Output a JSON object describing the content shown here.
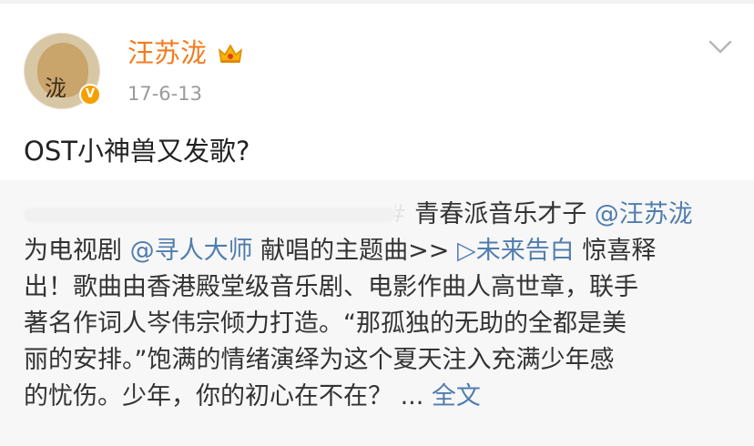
{
  "post": {
    "user": {
      "name": "汪苏泷",
      "avatar_text": "泷",
      "verified_badge": "v-badge-icon",
      "crown": "crown-icon"
    },
    "date": "17-6-13",
    "text": "OST小神兽又发歌?",
    "menu_icon": "chevron-down-icon"
  },
  "repost": {
    "line1": {
      "hash": "#",
      "text": " 青春派音乐才子 ",
      "mention": "@汪苏泷"
    },
    "line2": {
      "pre": "为电视剧 ",
      "mention": "@寻人大师",
      "mid": " 献唱的主题曲>> ",
      "link": "▷未来告白",
      "post": " 惊喜释"
    },
    "line3": "出！歌曲由香港殿堂级音乐剧、电影作曲人高世章，联手",
    "line4": "著名作词人岑伟宗倾力打造。“那孤独的无助的全都是美",
    "line5": "丽的安排。”饱满的情绪演绎为这个夏天注入充满少年感",
    "line6": {
      "text": "的忧伤。少年，你的初心在不在？ ... ",
      "more": "全文"
    }
  },
  "colors": {
    "username": "#f37b1d",
    "link": "#507daf",
    "repost_bg": "#f7f7f7",
    "text": "#222222",
    "date": "#9b9b9b"
  }
}
